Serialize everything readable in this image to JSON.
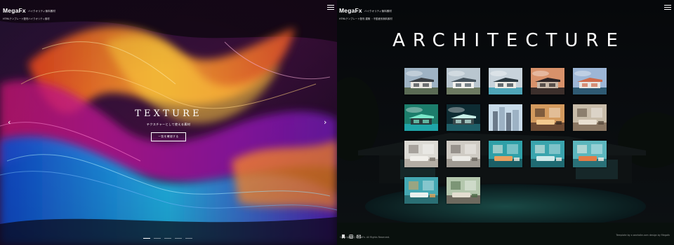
{
  "left_panel": {
    "brand": {
      "logo": "MegaFx",
      "tagline": "ハイクオリティ無料素材",
      "subtitle": "HTMLテンプレート配布ハイクオリティ素材"
    },
    "hero": {
      "title": "TEXTURE",
      "caption": "テクスチャーとして使える素材",
      "cta_label": "一覧を確認する"
    },
    "arrows": {
      "prev": "‹",
      "next": "›"
    },
    "slider": {
      "slide_count": 5,
      "active_index": 0
    }
  },
  "right_panel": {
    "brand": {
      "logo": "MegaFx",
      "tagline": "ハイクオリティ無料素材",
      "subtitle": "HTMLテンプレート配布 建築 ・不動産系無料素材"
    },
    "section_title": "ARCHITECTURE",
    "gallery": [
      {
        "theme": "modern-villa-day"
      },
      {
        "theme": "modern-villa-glass"
      },
      {
        "theme": "villa-pool"
      },
      {
        "theme": "villa-sunset"
      },
      {
        "theme": "villa-clouds"
      },
      {
        "theme": "villa-aurora"
      },
      {
        "theme": "villa-aurora-night"
      },
      {
        "theme": "city-towers"
      },
      {
        "theme": "interior-warm"
      },
      {
        "theme": "interior-living"
      },
      {
        "theme": "living-room-white"
      },
      {
        "theme": "living-room-window"
      },
      {
        "theme": "living-room-teal-orange"
      },
      {
        "theme": "living-room-teal"
      },
      {
        "theme": "living-room-teal-art"
      },
      {
        "theme": "interior-teal-kitchen"
      },
      {
        "theme": "interior-window-view"
      }
    ],
    "social_icons": [
      "bookmark-icon",
      "instagram-icon",
      "mail-icon"
    ],
    "footer": {
      "copyright": "Copyright (C) MegaFx. All Rights Reserved.",
      "credit": "Template by a worksite.com design by Megafx"
    }
  },
  "colors": {
    "text": "#ffffff",
    "bg_dark": "#0c0f12"
  }
}
